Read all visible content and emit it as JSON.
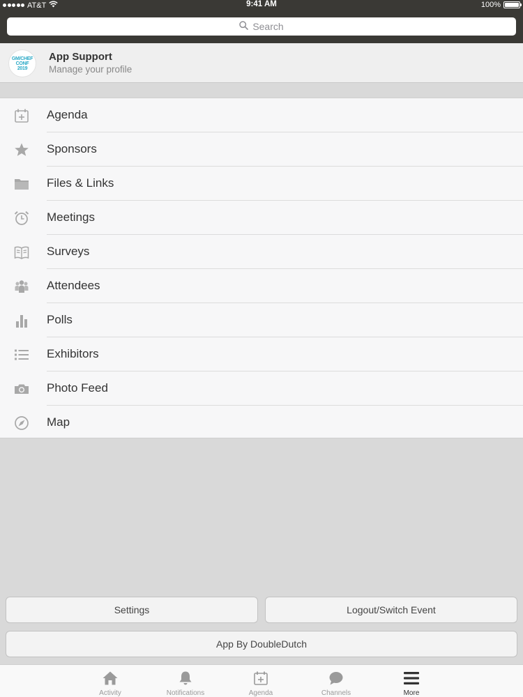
{
  "status": {
    "carrier": "AT&T",
    "time": "9:41 AM",
    "battery": "100%"
  },
  "search": {
    "placeholder": "Search",
    "icon": "search-icon"
  },
  "profile": {
    "avatar_lines": [
      "GM/CHEF",
      "CONF",
      "2019"
    ],
    "title": "App Support",
    "subtitle": "Manage your profile"
  },
  "menu": {
    "items": [
      {
        "label": "Agenda",
        "icon": "calendar-add-icon"
      },
      {
        "label": "Sponsors",
        "icon": "star-icon"
      },
      {
        "label": "Files & Links",
        "icon": "folder-icon"
      },
      {
        "label": "Meetings",
        "icon": "alarm-clock-icon"
      },
      {
        "label": "Surveys",
        "icon": "open-book-icon"
      },
      {
        "label": "Attendees",
        "icon": "people-icon"
      },
      {
        "label": "Polls",
        "icon": "bar-chart-icon"
      },
      {
        "label": "Exhibitors",
        "icon": "list-icon"
      },
      {
        "label": "Photo Feed",
        "icon": "camera-icon"
      },
      {
        "label": "Map",
        "icon": "compass-icon"
      }
    ]
  },
  "buttons": {
    "settings": "Settings",
    "logout": "Logout/Switch Event",
    "app_by": "App By DoubleDutch"
  },
  "tabbar": {
    "tabs": [
      {
        "label": "Activity",
        "icon": "home-icon"
      },
      {
        "label": "Notifications",
        "icon": "bell-icon"
      },
      {
        "label": "Agenda",
        "icon": "calendar-add-icon"
      },
      {
        "label": "Channels",
        "icon": "chat-bubble-icon"
      },
      {
        "label": "More",
        "icon": "hamburger-menu-icon"
      }
    ],
    "active": "More"
  },
  "colors": {
    "header_bg": "#3a3935",
    "page_bg": "#d9d9d9",
    "list_bg": "#f7f7f8",
    "icon_gray": "#a8a8a8",
    "avatar_accent": "#2aa9c6"
  }
}
